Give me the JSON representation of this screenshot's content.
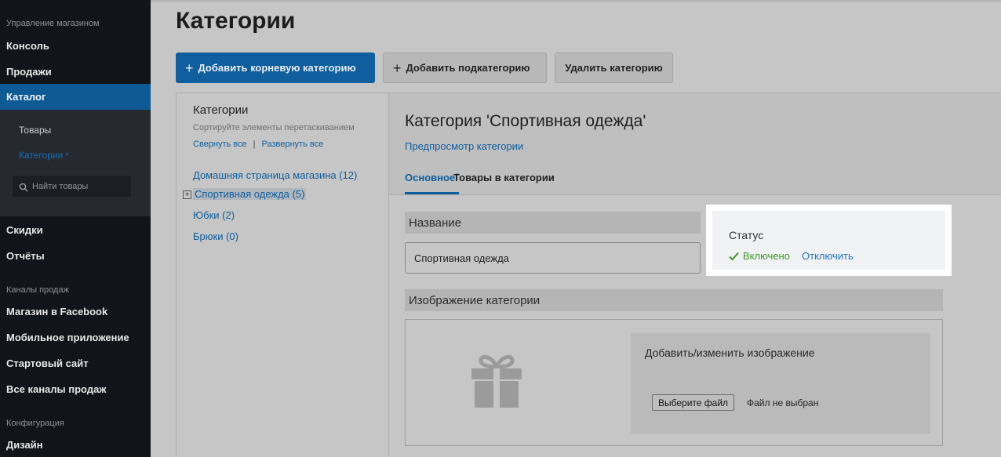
{
  "sidebar": {
    "section_store": "Управление магазином",
    "item_console": "Консоль",
    "item_sales": "Продажи",
    "item_catalog": "Каталог",
    "sub_products": "Товары",
    "sub_categories": "Категории",
    "sub_categories_star": "*",
    "search_placeholder": "Найти товары",
    "item_discounts": "Скидки",
    "item_reports": "Отчёты",
    "section_channels": "Каналы продаж",
    "item_facebook": "Магазин в Facebook",
    "item_mobile": "Мобильное приложение",
    "item_startsite": "Стартовый сайт",
    "item_allchannels": "Все каналы продаж",
    "section_config": "Конфигурация",
    "item_design": "Дизайн"
  },
  "header": {
    "title": "Категории",
    "btn_add_root": "Добавить корневую категорию",
    "btn_add_sub": "Добавить подкатегорию",
    "btn_delete": "Удалить категорию"
  },
  "tree": {
    "title": "Категории",
    "hint": "Сортируйте элементы перетаскиванием",
    "collapse_all": "Свернуть все",
    "separator": "|",
    "expand_all": "Развернуть все",
    "nodes": [
      "Домашняя страница магазина (12)",
      "Спортивная одежда (5)",
      "Юбки (2)",
      "Брюки (0)"
    ]
  },
  "detail": {
    "title": "Категория 'Спортивная одежда'",
    "preview_link": "Предпросмотр категории",
    "tab_main": "Основное",
    "tab_main_star": "*",
    "tab_products": "Товары в категории",
    "name_section": "Название",
    "name_value": "Спортивная одежда",
    "status_label": "Статус",
    "status_on": "Включено",
    "status_off": "Отключить",
    "image_section": "Изображение категории",
    "upload_title": "Добавить/изменить изображение",
    "choose_file": "Выберите файл",
    "no_file": "Файл не выбран"
  },
  "colors": {
    "accent": "#0f5e9e",
    "sidebar_bg": "#111419",
    "status_green": "#3c9b24",
    "link_blue": "#1e73c0"
  }
}
